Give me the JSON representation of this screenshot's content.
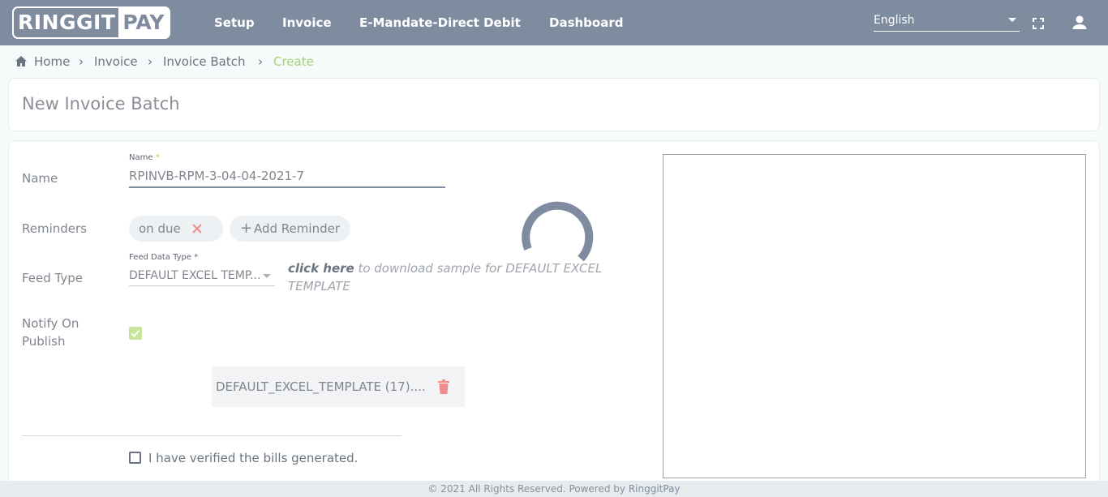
{
  "header": {
    "logo_left": "RINGGIT",
    "logo_right": "PAY",
    "nav": [
      "Setup",
      "Invoice",
      "E-Mandate-Direct Debit",
      "Dashboard"
    ],
    "language": "English"
  },
  "breadcrumb": [
    "Home",
    "Invoice",
    "Invoice Batch",
    "Create"
  ],
  "page": {
    "title": "New Invoice Batch"
  },
  "form": {
    "name_row_label": "Name",
    "name_field_label": "Name",
    "name_value": "RPINVB-RPM-3-04-04-2021-7",
    "reminders_label": "Reminders",
    "reminder_chip": "on due",
    "add_reminder": "Add Reminder",
    "feed_type_label": "Feed Type",
    "feed_field_label": "Feed Data Type",
    "feed_value": "DEFAULT EXCEL TEMP...",
    "hint_link": "click here",
    "hint_text": " to download sample for DEFAULT EXCEL TEMPLATE",
    "notify_label": "Notify On Publish",
    "notify_checked": true,
    "file_name": "DEFAULT_EXCEL_TEMPLATE (17)....",
    "verify_label": "I have verified the bills generated.",
    "verify_checked": false
  },
  "footer": {
    "text": "© 2021 All Rights Reserved. Powered by ",
    "brand": "RinggitPay"
  },
  "colors": {
    "header": "#7f8ca0",
    "accent": "#a5d36a",
    "danger": "#f28b8b"
  }
}
